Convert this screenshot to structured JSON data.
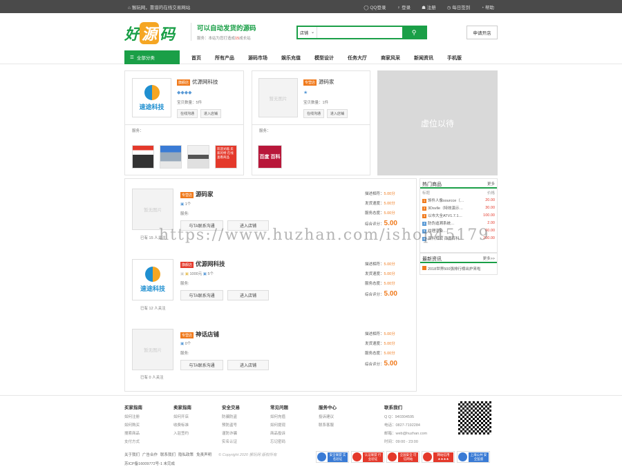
{
  "topbar": {
    "welcome": "⌂ 猴玩网，靠谱的在线交易网站",
    "links": [
      "◯ QQ登录",
      "♀ 登录",
      "☗ 注册",
      "◷ 每日签到",
      "◔ 帮助"
    ]
  },
  "header": {
    "logo": [
      "好",
      "源",
      "码"
    ],
    "slogan": "可以自动发货的源码",
    "sub_prefix": "服务：本站为您打造成",
    "sub_highlight": "15",
    "sub_suffix": "成长站",
    "search_select": "店铺",
    "search_placeholder": "",
    "apply": "申请开店"
  },
  "nav": {
    "category": "全部分类",
    "items": [
      "首页",
      "所有产品",
      "源码市场",
      "娱乐充值",
      "模型设计",
      "任务大厅",
      "商家风采",
      "新闻资讯",
      "手机版"
    ]
  },
  "top_shops": [
    {
      "tag": "旗舰店",
      "name": "优源网科技",
      "logo_text": "速途科技",
      "rating": "◆◆◆◆",
      "count_label": "宝贝数量：",
      "count": "5件",
      "btn1": "在线沟通",
      "btn2": "进入店铺",
      "services_label": "服务：",
      "thumbs": [
        "",
        "",
        "",
        "欢迎光临 卖家的特 在线查看商品"
      ]
    },
    {
      "tag": "专营店",
      "name": "源码家",
      "logo_text": "暂无图片",
      "rating": "★",
      "count_label": "宝贝数量：",
      "count": "1件",
      "btn1": "在线沟通",
      "btn2": "进入店铺",
      "services_label": "服务：",
      "thumbs": [
        "百度 百科"
      ]
    }
  ],
  "ad_text": "虚位以待",
  "shops": [
    {
      "tag": "专营店",
      "name": "源码家",
      "img": "暂无图片",
      "follow": "已有 15 人关注",
      "meta1": "1个",
      "meta2": "",
      "service": "服务:",
      "btn1": "与TA联系沟通",
      "btn2": "进入店铺",
      "scores": [
        "描述相符：",
        "5.00分",
        "发货速度：",
        "5.00分",
        "服务态度：",
        "5.00分",
        "综合评分：",
        "5.00"
      ]
    },
    {
      "tag": "旗舰店",
      "name": "优源网科技",
      "img": "速途科技",
      "follow": "已有 12 人关注",
      "meta1": "1000元",
      "meta2": "5个",
      "service": "服务:",
      "btn1": "与TA联系沟通",
      "btn2": "进入店铺",
      "scores": [
        "描述相符：",
        "5.00分",
        "发货速度：",
        "5.00分",
        "服务态度：",
        "5.00分",
        "综合评分：",
        "5.00"
      ]
    },
    {
      "tag": "专营店",
      "name": "神话店铺",
      "img": "暂无图片",
      "follow": "已有 0 人关注",
      "meta1": "0个",
      "meta2": "",
      "service": "服务:",
      "btn1": "与TA联系沟通",
      "btn2": "进入店铺",
      "scores": [
        "描述相符：",
        "5.00分",
        "发货速度：",
        "5.00分",
        "服务态度：",
        "5.00分",
        "综合评分：",
        "5.00"
      ]
    }
  ],
  "hot_products": {
    "title": "热门商品",
    "more": "更多",
    "col1": "标题",
    "col2": "价格",
    "rows": [
      [
        "1",
        "饰件人像sourcce（…",
        "20.00"
      ],
      [
        "2",
        "3Dsvlle（特效演示…",
        "30.00"
      ],
      [
        "3",
        "以市大全ATV1.7.1…",
        "100.00"
      ],
      [
        "4",
        "防伪追溯系统…",
        "2.00"
      ],
      [
        "5",
        "纹理渲染…",
        "60.00"
      ],
      [
        "6",
        "百科知识 百度百科…",
        "200.00"
      ]
    ]
  },
  "news": {
    "title": "最新资讯",
    "more": "更多>>",
    "items": [
      "2018世界500强排行榜出炉来啦"
    ]
  },
  "footer": {
    "cols": [
      {
        "h": "买家指南",
        "items": [
          "如何注册",
          "如何购买",
          "搜索商品",
          "支付方式"
        ]
      },
      {
        "h": "卖家指南",
        "items": [
          "如何开店",
          "收费标准",
          "入驻签约"
        ]
      },
      {
        "h": "安全交易",
        "items": [
          "防骗防盗",
          "预防盗号",
          "谨防诈骗",
          "实名认证"
        ]
      },
      {
        "h": "常见问题",
        "items": [
          "如何充值",
          "如何提现",
          "商品投诉",
          "忘记密码"
        ]
      },
      {
        "h": "服务中心",
        "items": [
          "投诉建议",
          "联系客服"
        ]
      },
      {
        "h": "联系我们",
        "items": [
          "Q Q：940304595",
          "电话：0827-7192284",
          "邮箱：web@huzhan.com",
          "时间：09:00 - 23:00"
        ]
      }
    ],
    "links": [
      "关于我们",
      "广告合作",
      "联系我们",
      "隐私政策",
      "免责声明"
    ],
    "copyright": "© Copyright 2020 猴玩网 版权所有",
    "icp": "苏ICP备16009772号-1 未完成",
    "badges": [
      "安全联盟 实名验证",
      "认证联盟 行业验证",
      "全国安全 可信网站",
      "网站信用 ★★★★",
      "上海公共 安全监督"
    ]
  },
  "watermark": "https://www.huzhan.com/ishop45179"
}
